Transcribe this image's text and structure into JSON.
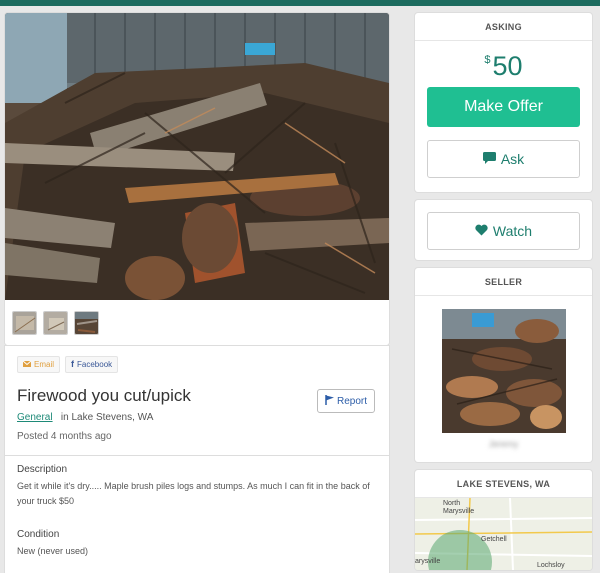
{
  "listing": {
    "title": "Firewood you cut/upick",
    "category": "General",
    "location_prefix": "in",
    "location": "Lake Stevens, WA",
    "posted": "Posted 4 months ago",
    "report_label": "Report",
    "share": {
      "email_label": "Email",
      "facebook_label": "Facebook"
    },
    "description_label": "Description",
    "description": "Get it while it's dry..... Maple brush piles logs and stumps. As much I can fit in the back of your truck $50",
    "condition_label": "Condition",
    "condition": "New (never used)",
    "photo_count": 3
  },
  "asking": {
    "heading": "ASKING",
    "currency": "$",
    "price": "50",
    "offer_label": "Make Offer",
    "ask_label": "Ask",
    "watch_label": "Watch"
  },
  "seller": {
    "heading": "SELLER",
    "name": "Jeremy"
  },
  "map": {
    "heading": "LAKE STEVENS, WA",
    "labels": {
      "north": "North",
      "marysville": "Marysville",
      "getchell": "Getchell",
      "marysville_south": "arysville",
      "lochsloy": "Lochsloy"
    }
  },
  "icons": {
    "email": "envelope-icon",
    "facebook": "facebook-icon",
    "report": "flag-icon",
    "ask": "speech-bubble-icon",
    "watch": "heart-icon"
  },
  "colors": {
    "accent": "#1fbf92",
    "link": "#1e8a78",
    "topbar": "#1c6b5e",
    "report": "#2c5da8"
  }
}
